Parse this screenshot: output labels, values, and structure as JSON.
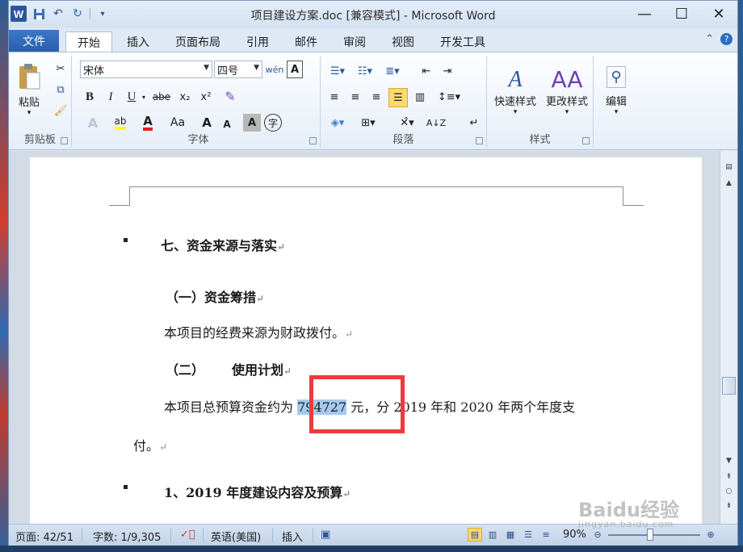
{
  "window": {
    "title": "项目建设方案.doc [兼容模式] - Microsoft Word",
    "controls": {
      "minimize": "—",
      "maximize": "☐",
      "close": "✕"
    }
  },
  "qat": {
    "logo": "W",
    "save_icon": "save-icon",
    "undo_icon": "undo-icon",
    "redo_icon": "redo-icon"
  },
  "tabs": {
    "file": "文件",
    "items": [
      "开始",
      "插入",
      "页面布局",
      "引用",
      "邮件",
      "审阅",
      "视图",
      "开发工具"
    ],
    "active": "开始"
  },
  "ribbon": {
    "clipboard": {
      "label": "剪贴板",
      "paste": "粘贴"
    },
    "font": {
      "label": "字体",
      "font_name": "宋体",
      "font_size": "四号",
      "bold": "B",
      "italic": "I",
      "underline": "U",
      "strike": "abe",
      "subscript": "x₂",
      "superscript": "x²",
      "font_color": "A",
      "change_case": "Aa",
      "grow": "A",
      "shrink": "A"
    },
    "paragraph": {
      "label": "段落"
    },
    "styles": {
      "label": "样式",
      "quick_styles": "快速样式",
      "change_styles": "更改样式"
    },
    "editing": {
      "label": "编辑"
    }
  },
  "document": {
    "heading1": "七、资金来源与落实",
    "heading2": "（一）资金筹措",
    "para1": "本项目的经费来源为财政拨付。",
    "heading3_num": "（二）",
    "heading3_text": "使用计划",
    "para2_before": "本项目总预算资金约为",
    "para2_selected": "794727",
    "para2_after": "元，分 2019 年和 2020 年两个年度支",
    "para2_cont": "付。",
    "heading4": "1、2019 年度建设内容及预算",
    "para_mark": "↵"
  },
  "statusbar": {
    "page": "页面: 42/51",
    "words": "字数: 1/9,305",
    "language": "英语(美国)",
    "insert_mode": "插入",
    "zoom": "90%"
  },
  "watermark": {
    "brand": "Baidu经验",
    "url": "jingyan.baidu.com"
  },
  "colors": {
    "selection": "#a6c9ef",
    "annotation_box": "#f0383d",
    "file_tab": "#2a5ea8"
  }
}
